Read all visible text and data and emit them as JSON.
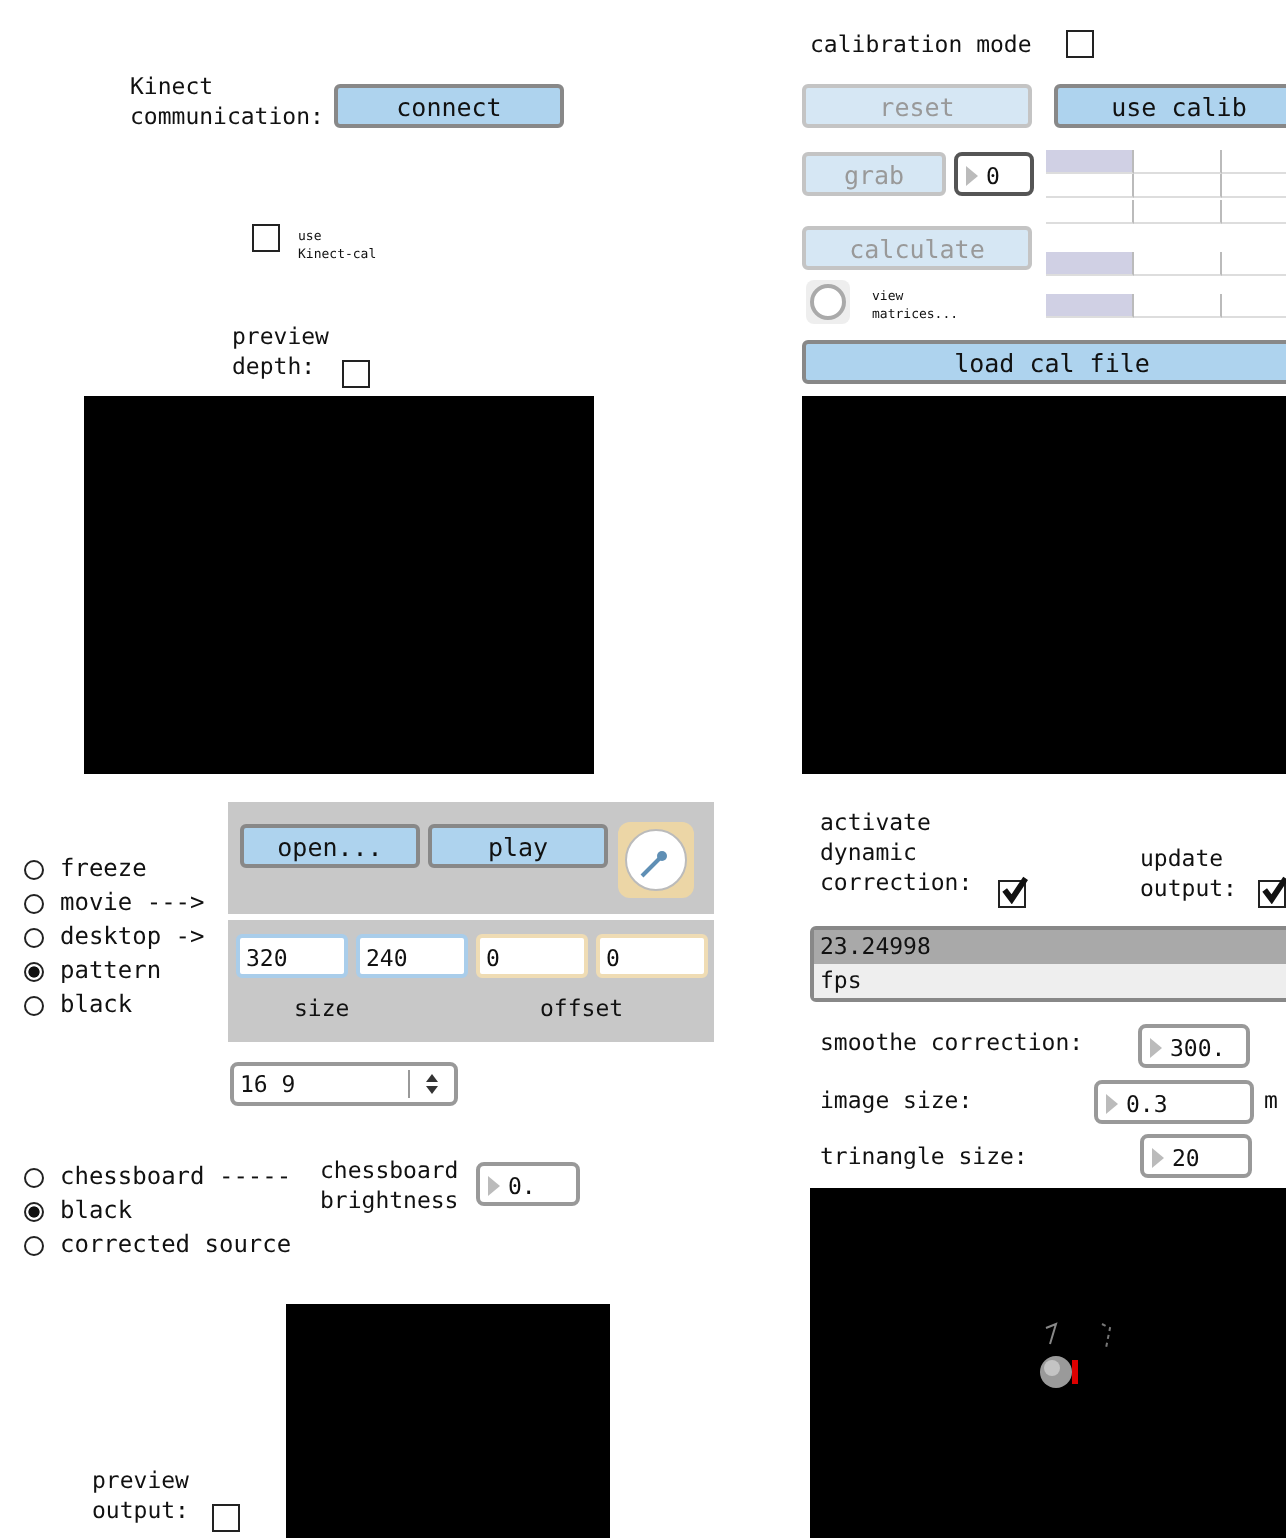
{
  "kinect_communication": {
    "label": "Kinect\ncommunication:",
    "button": "connect"
  },
  "use_kinect_cal": {
    "label": "use\nKinect-cal",
    "checked": false
  },
  "preview_depth": {
    "label": "preview\ndepth:",
    "checked": false
  },
  "calibration": {
    "mode_label": "calibration mode",
    "mode_checked": false,
    "reset": {
      "label": "reset",
      "disabled": true
    },
    "use_calib": {
      "label": "use calib",
      "disabled": false
    },
    "grab": {
      "label": "grab",
      "disabled": true
    },
    "grab_number": "0",
    "calculate": {
      "label": "calculate",
      "disabled": true
    },
    "view_matrices": {
      "label": "view\nmatrices...",
      "on": false
    },
    "load_cal_file": "load cal file",
    "matrix_rows": [
      {
        "cells": [
          {
            "selected": true
          },
          {
            "selected": false
          },
          {
            "selected": false
          }
        ]
      },
      {
        "cells": [
          {
            "selected": false
          },
          {
            "selected": false
          },
          {
            "selected": false
          }
        ]
      },
      {
        "cells": [
          {
            "selected": false
          },
          {
            "selected": false
          },
          {
            "selected": false
          }
        ]
      },
      {
        "cells": [
          {
            "selected": true
          },
          {
            "selected": false
          },
          {
            "selected": false
          }
        ]
      },
      {
        "cells": [
          {
            "selected": true
          },
          {
            "selected": false
          },
          {
            "selected": false
          }
        ]
      }
    ]
  },
  "source_modes": [
    {
      "label": "freeze",
      "selected": false
    },
    {
      "label": "movie --->",
      "selected": false
    },
    {
      "label": "desktop ->",
      "selected": false
    },
    {
      "label": "pattern",
      "selected": true
    },
    {
      "label": "black",
      "selected": false
    }
  ],
  "movie_panel": {
    "open_button": "open...",
    "play_button": "play"
  },
  "desktop_panel": {
    "size_fields": [
      "320",
      "240"
    ],
    "size_label": "size",
    "offset_fields": [
      "0",
      "0"
    ],
    "offset_label": "offset"
  },
  "aspect_menu": {
    "value": "16 9"
  },
  "output_modes": [
    {
      "label": "chessboard -----",
      "selected": false
    },
    {
      "label": "black",
      "selected": true
    },
    {
      "label": "corrected source",
      "selected": false
    }
  ],
  "chessboard_brightness": {
    "label": "chessboard\nbrightness",
    "value": "0."
  },
  "preview_output": {
    "label": "preview\noutput:",
    "checked": false
  },
  "dynamic_correction": {
    "label": "activate\ndynamic\ncorrection:",
    "checked": true
  },
  "update_output": {
    "label": "update\noutput:",
    "checked": true
  },
  "fps_display": {
    "value": "23.24998",
    "unit": "fps"
  },
  "smoothe_correction": {
    "label": "smoothe correction:",
    "value": "300."
  },
  "image_size": {
    "label": "image size:",
    "value": "0.3",
    "unit": "m"
  },
  "triangle_size": {
    "label": "trinangle size:",
    "value": "20"
  }
}
